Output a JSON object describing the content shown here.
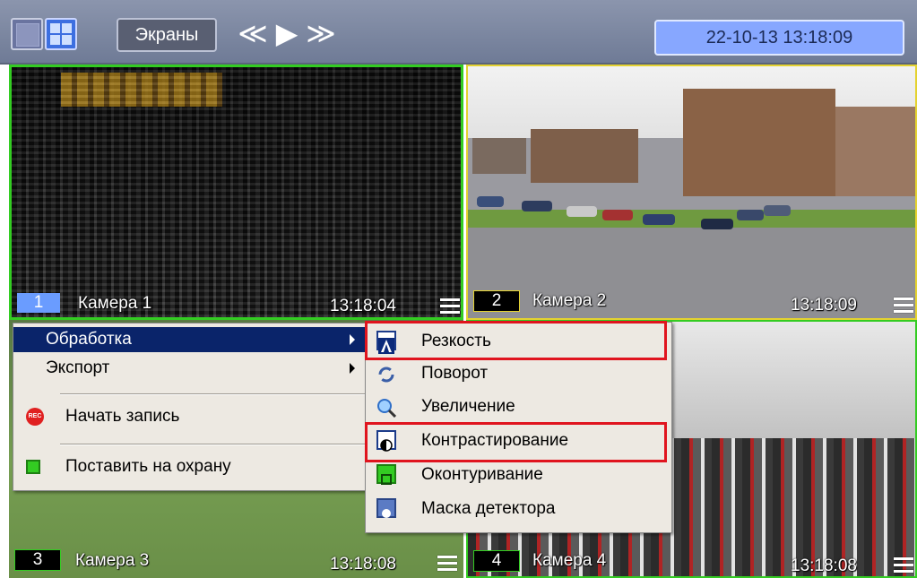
{
  "toolbar": {
    "single_view_icon": "single-screen-icon",
    "grid_view_icon": "grid-2x2-icon",
    "screens_label": "Экраны",
    "prev_glyph": "≪",
    "play_glyph": "▶",
    "next_glyph": "≫",
    "datetime": "22-10-13  13:18:09"
  },
  "cameras": [
    {
      "number": "1",
      "name": "Камера 1",
      "time": "13:18:04",
      "number_bg": "#6a9cff"
    },
    {
      "number": "2",
      "name": "Камера 2",
      "time": "13:18:09",
      "number_bg": "#000000"
    },
    {
      "number": "3",
      "name": "Камера 3",
      "time": "13:18:08",
      "number_bg": "#000000"
    },
    {
      "number": "4",
      "name": "Камера 4",
      "time": "13:18:08",
      "number_bg": "#000000"
    }
  ],
  "context_menu": {
    "items": [
      {
        "label": "Обработка",
        "has_submenu": true,
        "selected": true
      },
      {
        "label": "Экспорт",
        "has_submenu": true,
        "selected": false
      },
      {
        "label": "Начать запись",
        "icon": "rec-icon"
      },
      {
        "label": "Поставить на охрану",
        "icon": "arm-icon"
      }
    ]
  },
  "submenu": {
    "items": [
      {
        "label": "Резкость",
        "icon": "sharpness-icon",
        "highlighted": true
      },
      {
        "label": "Поворот",
        "icon": "rotate-icon"
      },
      {
        "label": "Увеличение",
        "icon": "zoom-icon"
      },
      {
        "label": "Контрастирование",
        "icon": "contrast-icon",
        "highlighted": true
      },
      {
        "label": "Оконтуривание",
        "icon": "outline-icon"
      },
      {
        "label": "Маска детектора",
        "icon": "detector-mask-icon"
      }
    ]
  },
  "colors": {
    "active_border": "#33cc22",
    "alarm_border": "#e4d230",
    "highlight": "#e0141e",
    "menu_selected": "#0a246a"
  }
}
